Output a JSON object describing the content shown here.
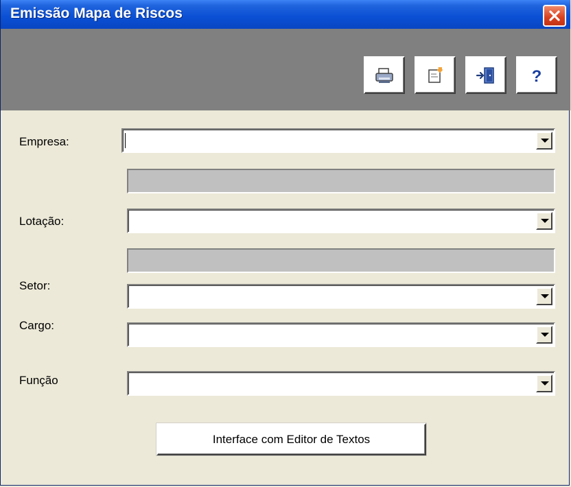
{
  "window": {
    "title": "Emissão Mapa de Riscos",
    "close_icon": "close-icon"
  },
  "toolbar": {
    "buttons": [
      {
        "name": "print-button",
        "icon": "printer-icon"
      },
      {
        "name": "edit-button",
        "icon": "edit-document-icon"
      },
      {
        "name": "exit-button",
        "icon": "exit-door-icon"
      },
      {
        "name": "help-button",
        "icon": "help-icon",
        "glyph": "?"
      }
    ]
  },
  "form": {
    "empresa": {
      "label": "Empresa:",
      "value": ""
    },
    "empresa_desc": {
      "value": ""
    },
    "lotacao": {
      "label": "Lotação:",
      "value": ""
    },
    "lotacao_desc": {
      "value": ""
    },
    "setor": {
      "label": "Setor:",
      "value": ""
    },
    "cargo": {
      "label": "Cargo:",
      "value": ""
    },
    "funcao": {
      "label": "Função",
      "value": ""
    }
  },
  "actions": {
    "editor_button_label": "Interface com Editor de Textos"
  },
  "colors": {
    "titlebar": "#0a4fd4",
    "toolbar": "#808080",
    "window_bg": "#ece9d8",
    "readonly_bg": "#c0c0c0",
    "close_button": "#d9401e"
  }
}
